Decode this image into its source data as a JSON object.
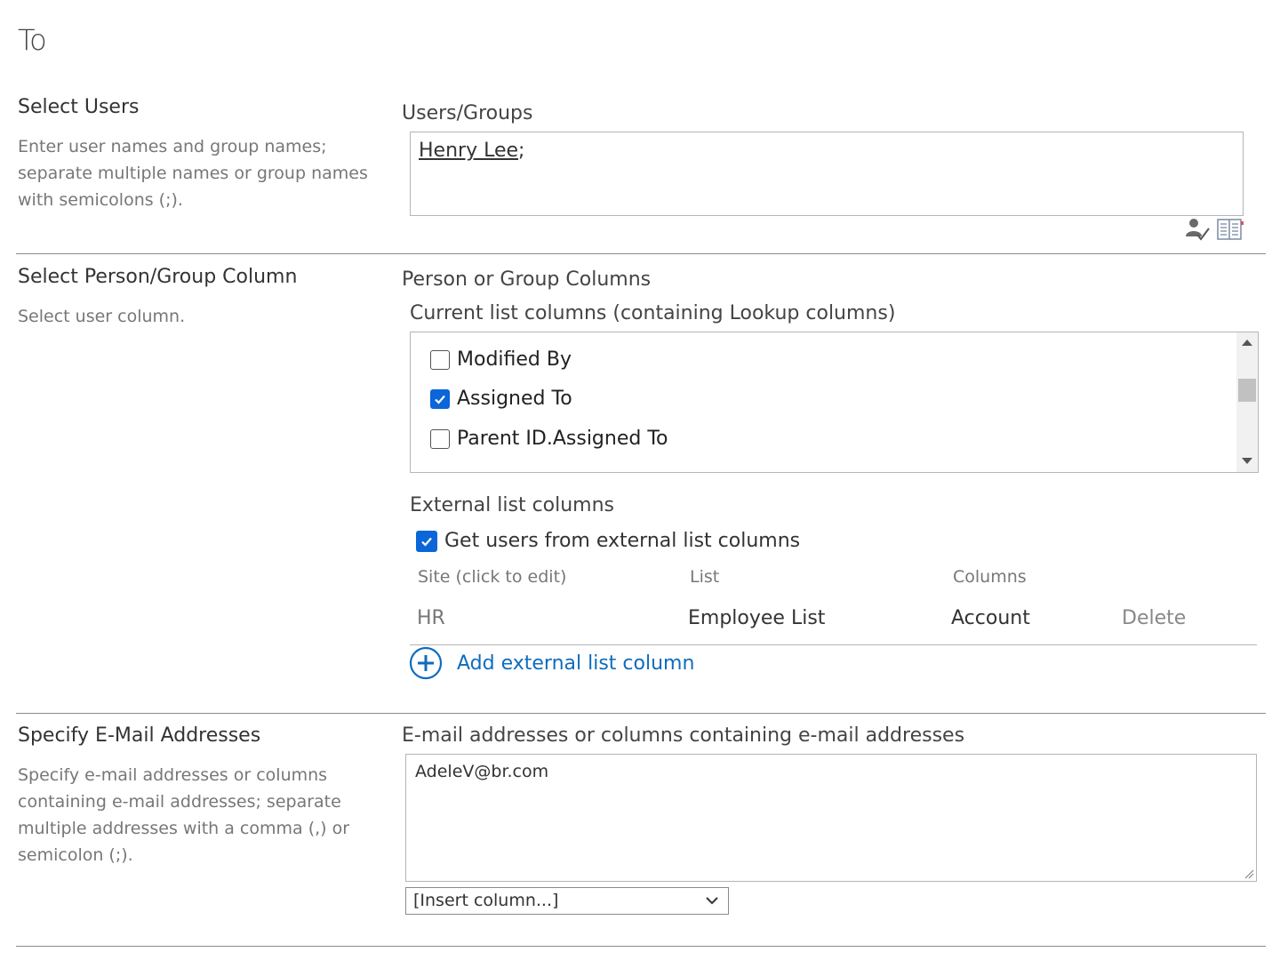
{
  "page": {
    "title": "To"
  },
  "select_users": {
    "title": "Select Users",
    "description": "Enter user names and group names; separate multiple names or group names with semicolons (;).",
    "field_label": "Users/Groups",
    "value_name": "Henry Lee",
    "value_suffix": ";",
    "icons": {
      "check_names": "check-names-icon",
      "browse": "address-book-icon"
    }
  },
  "person_group": {
    "title": "Select Person/Group Column",
    "description": "Select user column.",
    "field_label": "Person or Group Columns",
    "current_label": "Current list columns (containing Lookup columns)",
    "columns": [
      {
        "label": "Modified By",
        "checked": false
      },
      {
        "label": "Assigned To",
        "checked": true
      },
      {
        "label": "Parent ID.Assigned To",
        "checked": false
      }
    ],
    "external_label": "External list columns",
    "external_checkbox_label": "Get users from external list columns",
    "external_checked": true,
    "table": {
      "headers": [
        "Site (click to edit)",
        "List",
        "Columns"
      ],
      "rows": [
        {
          "site": "HR",
          "list": "Employee List",
          "column": "Account",
          "action": "Delete"
        }
      ]
    },
    "add_link": "Add external list column"
  },
  "email": {
    "title": "Specify E-Mail Addresses",
    "description": "Specify e-mail addresses or columns containing e-mail addresses; separate multiple addresses with a comma (,) or semicolon (;).",
    "field_label": "E-mail addresses or columns containing e-mail addresses",
    "value": "AdeleV@br.com",
    "insert_column": "[Insert column...]"
  },
  "colors": {
    "accent": "#0f6cbd",
    "checkbox": "#0a66d9"
  }
}
